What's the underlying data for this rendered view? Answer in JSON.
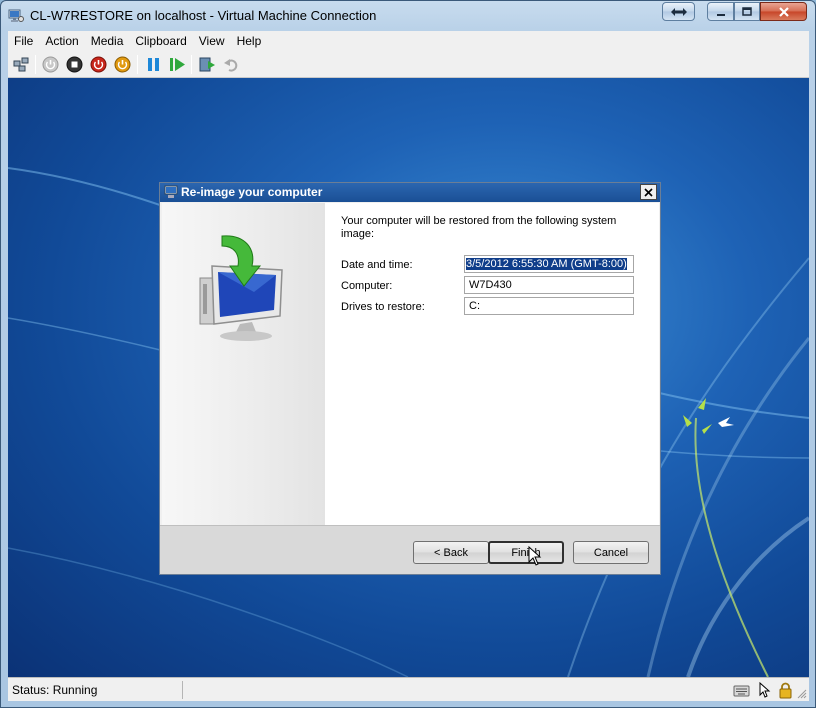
{
  "window": {
    "title": "CL-W7RESTORE on localhost - Virtual Machine Connection"
  },
  "menu": [
    "File",
    "Action",
    "Media",
    "Clipboard",
    "View",
    "Help"
  ],
  "toolbar": {
    "icons": [
      "ctrl-alt-del-icon",
      "start-icon",
      "turn-off-icon",
      "shut-down-icon",
      "save-state-icon",
      "pause-icon",
      "resume-icon",
      "snapshot-icon",
      "revert-icon"
    ]
  },
  "dialog": {
    "title": "Re-image your computer",
    "intro": "Your computer will be restored from the following system image:",
    "fields": [
      {
        "label": "Date and time:",
        "value": "3/5/2012 6:55:30 AM (GMT-8:00)"
      },
      {
        "label": "Computer:",
        "value": "W7D430"
      },
      {
        "label": "Drives to restore:",
        "value": "C:"
      }
    ],
    "buttons": {
      "back": "< Back",
      "finish": "Finish",
      "cancel": "Cancel"
    }
  },
  "status": {
    "text": "Status: Running"
  },
  "colors": {
    "dialog_title": "#1a4f95",
    "desktop": "#1e62b5",
    "selection": "#0f3d8a"
  }
}
